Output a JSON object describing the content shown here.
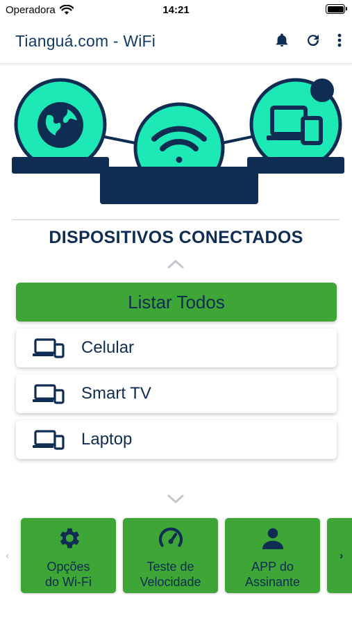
{
  "status_bar": {
    "carrier": "Operadora",
    "time": "14:21"
  },
  "app_bar": {
    "title": "Tianguá.com - WiFi",
    "icons": [
      "bell-icon",
      "refresh-icon",
      "more-vert-icon"
    ]
  },
  "hero": {
    "icons": [
      "globe-icon",
      "wifi-icon",
      "devices-icon"
    ]
  },
  "section": {
    "title": "DISPOSITIVOS CONECTADOS"
  },
  "list_all_label": "Listar Todos",
  "devices": [
    {
      "label": "Celular",
      "icon": "devices-icon"
    },
    {
      "label": "Smart TV",
      "icon": "devices-icon"
    },
    {
      "label": "Laptop",
      "icon": "devices-icon"
    }
  ],
  "actions": [
    {
      "label": "Opções\ndo Wi-Fi",
      "icon": "gear-icon"
    },
    {
      "label": "Teste de\nVelocidade",
      "icon": "speedometer-icon"
    },
    {
      "label": "APP do\nAssinante",
      "icon": "user-icon"
    }
  ],
  "colors": {
    "navy": "#0f2c52",
    "green": "#3ea537",
    "mint": "#1de9b6"
  }
}
